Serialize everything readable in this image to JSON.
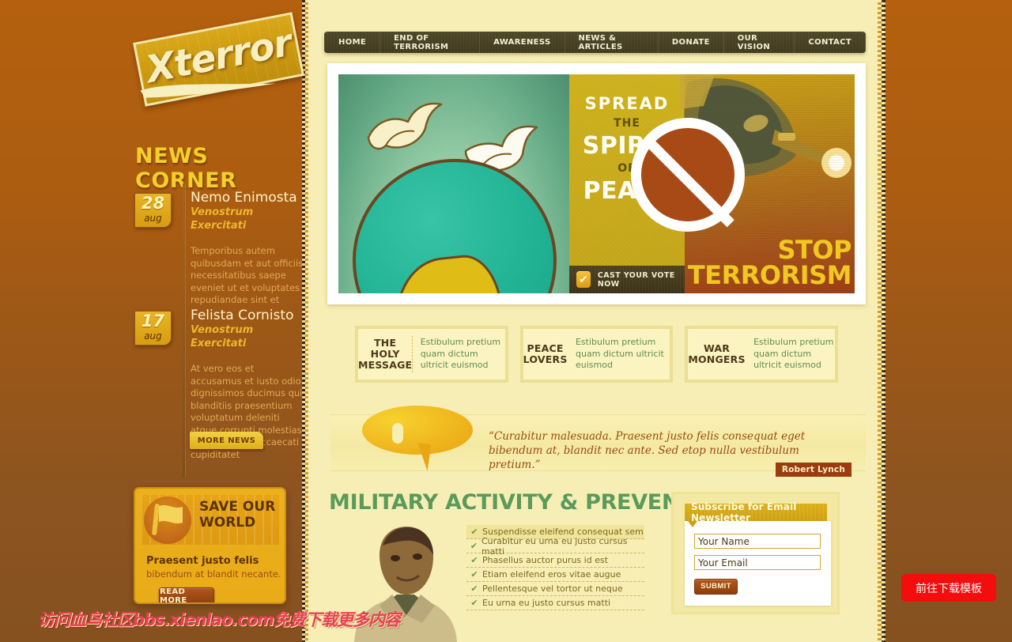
{
  "site": {
    "logo_text": "Xterror",
    "news_corner_title": "NEWS CORNER"
  },
  "nav": {
    "items": [
      {
        "label": "HOME"
      },
      {
        "label": "END OF TERRORISM"
      },
      {
        "label": "AWARENESS"
      },
      {
        "label": "NEWS & ARTICLES"
      },
      {
        "label": "DONATE"
      },
      {
        "label": "OUR VISION"
      },
      {
        "label": "CONTACT"
      }
    ]
  },
  "sidebar": {
    "news": [
      {
        "day": "28",
        "month": "aug",
        "title": "Nemo Enimosta",
        "subtitle": "Venostrum Exercitati",
        "text": "Temporibus autem quibusdam et aut officiis necessitatibus saepe eveniet ut et voluptates repudiandae sint et"
      },
      {
        "day": "17",
        "month": "aug",
        "title": "Felista Cornisto",
        "subtitle": "Venostrum Exercitati",
        "text": "At vero eos et accusamus et iusto odio dignissimos ducimus qui blanditiis praesentium voluptatum deleniti atque corrupti molestias excepturi sint occaecati cupiditatet"
      }
    ],
    "more_news_label": "MORE NEWS",
    "promo": {
      "banner_line1": "SAVE OUR",
      "banner_line2": "WORLD",
      "heading": "Praesent justo felis",
      "text": "bibendum at blandit necante.",
      "button_label": "READ MORE"
    }
  },
  "banner": {
    "peace": {
      "l1": "SPREAD",
      "l2": "THE",
      "l3": "SPIRIT",
      "l4": "OF",
      "l5": "PEACE"
    },
    "vote_label": "CAST YOUR VOTE NOW",
    "vote_check_glyph": "✔",
    "stop": {
      "line1": "STOP",
      "line2": "TERRORISM"
    }
  },
  "features": [
    {
      "title": "THE HOLY\nMESSAGE",
      "text": "Estibulum pretium quam dictum ultricit euismod"
    },
    {
      "title": "PEACE\nLOVERS",
      "text": "Estibulum pretium quam dictum ultricit euismod"
    },
    {
      "title": "WAR\nMONGERS",
      "text": "Estibulum pretium quam dictum ultricit euismod"
    }
  ],
  "quote": {
    "text": "“Curabitur malesuada. Praesent justo felis consequat eget bibendum at, blandit nec ante. Sed etop nulla vestibulum pretium.”",
    "author": "Robert Lynch"
  },
  "military": {
    "title": "MILITARY ACTIVITY & PREVENTION",
    "check_glyph": "✔",
    "items": [
      "Suspendisse eleifend consequat sem",
      "Curabitur eu urna eu justo cursus matti",
      "Phasellus auctor purus id est",
      "Etiam eleifend eros vitae augue",
      "Pellentesque vel tortor ut neque",
      "Eu urna eu justo cursus matti"
    ]
  },
  "newsletter": {
    "header": "Subscribe for Email Newsletter",
    "name_placeholder": "Your Name",
    "name_value": "",
    "email_placeholder": "Your Email",
    "email_value": "",
    "submit_label": "SUBMIT"
  },
  "overlay": {
    "watermark": "访问血鸟社区bbs.xienlao.com免费下载更多内容",
    "download_label": "前往下载模板"
  },
  "colors": {
    "page_bg": "#f6eeb4",
    "outer_bg": "#a85d13",
    "nav_bg": "#473f23",
    "gold": "#e2a716",
    "green": "#5a9b5a",
    "accent_red": "#f40d0d"
  }
}
